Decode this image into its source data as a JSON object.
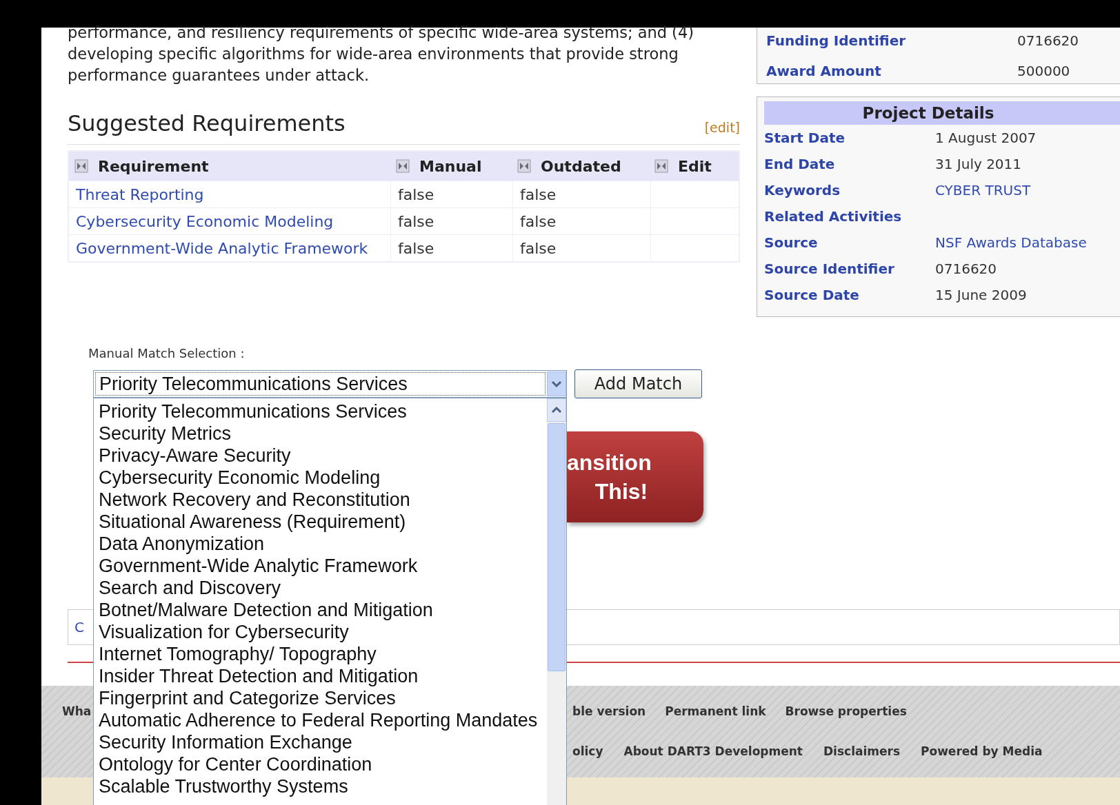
{
  "description": {
    "lines": [
      "performance, and resiliency requirements of specific wide-area systems; and (4)",
      "developing specific algorithms for wide-area environments that provide strong",
      "performance guarantees under attack."
    ]
  },
  "suggested_requirements": {
    "title": "Suggested Requirements",
    "edit_link": "[edit]",
    "columns": [
      "Requirement",
      "Manual",
      "Outdated",
      "Edit"
    ],
    "rows": [
      {
        "requirement": "Threat Reporting",
        "manual": "false",
        "outdated": "false"
      },
      {
        "requirement": "Cybersecurity Economic Modeling",
        "manual": "false",
        "outdated": "false"
      },
      {
        "requirement": "Government-Wide Analytic Framework",
        "manual": "false",
        "outdated": "false"
      }
    ]
  },
  "funding": [
    {
      "label": "Funding Identifier",
      "value": "0716620"
    },
    {
      "label": "Award Amount",
      "value": "500000"
    }
  ],
  "project_details": {
    "title": "Project Details",
    "rows": [
      {
        "label": "Start Date",
        "value": "1 August 2007",
        "kind": "text"
      },
      {
        "label": "End Date",
        "value": "31 July 2011",
        "kind": "text"
      },
      {
        "label": "Keywords",
        "value": "CYBER TRUST",
        "kind": "link"
      },
      {
        "label": "Related Activities"
      },
      {
        "label": "Source",
        "value": "NSF Awards Database",
        "kind": "link"
      },
      {
        "label": "Source Identifier",
        "value": "0716620",
        "kind": "text"
      },
      {
        "label": "Source Date",
        "value": "15 June 2009",
        "kind": "text"
      }
    ]
  },
  "manual_match": {
    "label": "Manual Match Selection :",
    "selected_value": "Priority Telecommunications Services",
    "button": "Add Match",
    "options": [
      "Priority Telecommunications Services",
      "Security Metrics",
      "Privacy-Aware Security",
      "Cybersecurity Economic Modeling",
      "Network Recovery and Reconstitution",
      "Situational Awareness (Requirement)",
      "Data Anonymization",
      "Government-Wide Analytic Framework",
      "Search and Discovery",
      "Botnet/Malware Detection and Mitigation",
      "Visualization for Cybersecurity",
      "Internet Tomography/ Topography",
      "Insider Threat Detection and Mitigation",
      "Fingerprint and Categorize Services",
      "Automatic Adherence to Federal Reporting Mandates",
      "Security Information Exchange",
      "Ontology for Center Coordination",
      "Scalable Trustworthy Systems"
    ]
  },
  "transition_button": {
    "lines": [
      "ansition",
      "This!"
    ]
  },
  "category_box": {
    "text": "C"
  },
  "footer": {
    "row_1_left": "Wha",
    "row_1": [
      "ble version",
      "Permanent link",
      "Browse properties"
    ],
    "row_2": [
      "olicy",
      "About DART3 Development",
      "Disclaimers",
      "Powered by Media"
    ]
  }
}
